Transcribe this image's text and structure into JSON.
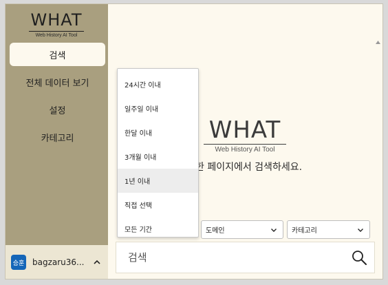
{
  "sidebar": {
    "logo": {
      "word": "WHAT",
      "subtitle": "Web History AI Tool"
    },
    "items": [
      {
        "label": "검색",
        "active": true
      },
      {
        "label": "전체 데이터 보기",
        "active": false
      },
      {
        "label": "설정",
        "active": false
      },
      {
        "label": "카테고리",
        "active": false
      }
    ],
    "user": {
      "avatar_text": "승훈",
      "name": "bagzaru36...",
      "avatar_color": "#1566b8"
    }
  },
  "main": {
    "logo": {
      "word": "WHAT",
      "subtitle": "Web History AI Tool"
    },
    "tagline": "한 페이지에서 검색하세요.",
    "filters": {
      "domain_label": "도메인",
      "category_label": "카테고리"
    },
    "search": {
      "placeholder": "검색"
    }
  },
  "dropdown": {
    "options": [
      "24시간 이내",
      "일주일 이내",
      "한달 이내",
      "3개월 이내",
      "1년 이내",
      "직접 선택",
      "모든 기간"
    ],
    "highlighted": "1년 이내"
  },
  "colors": {
    "sidebar_bg": "#a99f7f",
    "main_bg": "#fdf9ee",
    "user_bg": "#ece6d3"
  }
}
